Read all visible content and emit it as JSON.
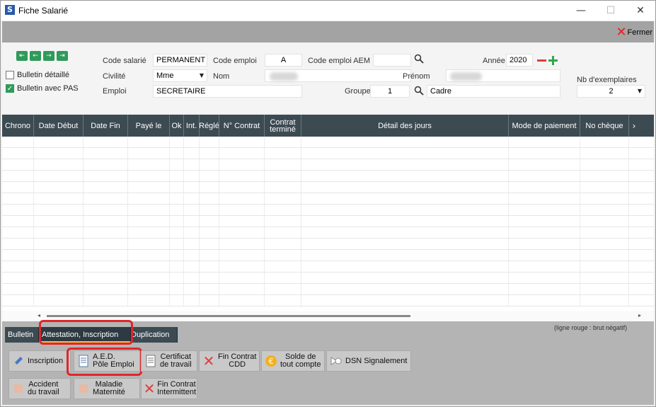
{
  "window": {
    "title": "Fiche Salarié",
    "app_icon_letter": "S",
    "minimize": "—",
    "maximize": "☐",
    "close": "✕"
  },
  "toolbar": {
    "close_label": "Fermer"
  },
  "nav": {
    "first": "⇤",
    "prev": "←",
    "next": "→",
    "last": "⇥"
  },
  "options": {
    "bulletin_detaille": {
      "label": "Bulletin détaillé",
      "checked": false
    },
    "bulletin_pas": {
      "label": "Bulletin avec PAS",
      "checked": true
    }
  },
  "form": {
    "code_salarie": {
      "label": "Code salarié",
      "value": "PERMANENT"
    },
    "code_emploi": {
      "label": "Code emploi",
      "value": "A"
    },
    "code_emploi_aem": {
      "label": "Code emploi AEM",
      "value": ""
    },
    "annee": {
      "label": "Année",
      "value": "2020"
    },
    "civilite": {
      "label": "Civilité",
      "value": "Mme"
    },
    "nom": {
      "label": "Nom",
      "value": ""
    },
    "prenom": {
      "label": "Prénom",
      "value": ""
    },
    "emploi": {
      "label": "Emploi",
      "value": "SECRETAIRE"
    },
    "groupe": {
      "label": "Groupe",
      "value": "1",
      "desc": "Cadre"
    },
    "exemplaires": {
      "label": "Nb d'exemplaires",
      "value": "2"
    }
  },
  "table": {
    "columns": [
      {
        "key": "chrono",
        "label": "Chrono",
        "width": 45
      },
      {
        "key": "date_debut",
        "label": "Date Début",
        "width": 70
      },
      {
        "key": "date_fin",
        "label": "Date Fin",
        "width": 63
      },
      {
        "key": "paye_le",
        "label": "Payé le",
        "width": 59
      },
      {
        "key": "ok",
        "label": "Ok",
        "width": 20
      },
      {
        "key": "int",
        "label": "Int.",
        "width": 22
      },
      {
        "key": "regle",
        "label": "Réglé",
        "width": 28
      },
      {
        "key": "no_contrat",
        "label": "N° Contrat",
        "width": 64
      },
      {
        "key": "contrat_termine",
        "label": "Contrat terminé",
        "width": 52
      },
      {
        "key": "detail_jours",
        "label": "Détail des jours",
        "width": 293
      },
      {
        "key": "mode_paiement",
        "label": "Mode de paiement",
        "width": 101
      },
      {
        "key": "no_cheque",
        "label": "No chèque",
        "width": 69
      }
    ],
    "more_icon": "›",
    "row_count": 15
  },
  "scroll": {
    "left": "◂",
    "right": "▸"
  },
  "note": "(ligne rouge : brut négatif)",
  "tabs": [
    {
      "label": "Bulletin",
      "active": false
    },
    {
      "label": "Attestation, Inscription",
      "active": true
    },
    {
      "label": "Duplication",
      "active": false
    }
  ],
  "actions": {
    "inscription": "Inscription",
    "aed_line1": "A.E.D.",
    "aed_line2": "Pôle Emploi",
    "certificat_line1": "Certificat",
    "certificat_line2": "de travail",
    "fin_cdd_line1": "Fin Contrat",
    "fin_cdd_line2": "CDD",
    "solde_line1": "Solde de",
    "solde_line2": "tout compte",
    "dsn": "DSN Signalement",
    "accident_line1": "Accident",
    "accident_line2": "du travail",
    "maladie_line1": "Maladie",
    "maladie_line2": "Maternité",
    "fin_int_line1": "Fin Contrat",
    "fin_int_line2": "Intermittent"
  },
  "colors": {
    "header_bg": "#3c4a52",
    "green": "#2f9a5a",
    "red_highlight": "#e0262b",
    "toolbar_grey": "#a3a3a3"
  }
}
